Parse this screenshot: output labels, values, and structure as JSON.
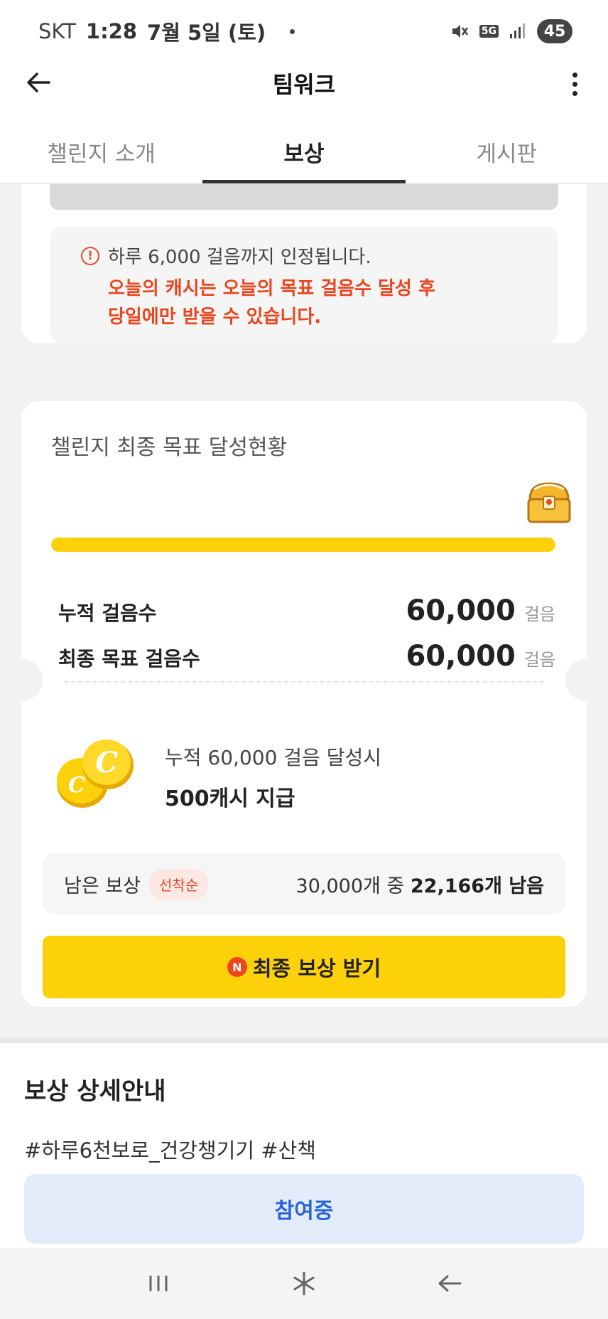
{
  "status_bar": {
    "carrier": "SKT",
    "time": "1:28",
    "date": "7월 5일 (토)",
    "network": "5G",
    "battery": "45"
  },
  "header": {
    "title": "팀워크"
  },
  "tabs": [
    {
      "label": "챌린지 소개",
      "active": false
    },
    {
      "label": "보상",
      "active": true
    },
    {
      "label": "게시판",
      "active": false
    }
  ],
  "notice": {
    "line1": "하루 6,000 걸음까지 인정됩니다.",
    "line2": "오늘의 캐시는 오늘의 목표 걸음수 달성 후",
    "line3": "당일에만 받을 수 있습니다."
  },
  "goal": {
    "title": "챌린지 최종 목표 달성현황",
    "progress": 1.0,
    "accumulated_label": "누적 걸음수",
    "accumulated_value": "60,000",
    "target_label": "최종 목표 걸음수",
    "target_value": "60,000",
    "unit": "걸음",
    "reward_condition": "누적 60,000 걸음 달성시",
    "reward_amount": "500캐시 지급",
    "remain_label": "남은 보상",
    "remain_badge": "선착순",
    "remain_prefix": "30,000개 중",
    "remain_count": "22,166개 남음",
    "claim_button": "최종 보상 받기",
    "claim_icon_letter": "N"
  },
  "detail": {
    "title": "보상 상세안내",
    "hashtags": "#하루6천보로_건강챙기기 #산책",
    "join_button": "참여중"
  },
  "colors": {
    "accent_yellow": "#fdd10a",
    "warning_red": "#e8461e",
    "join_blue": "#2a63d6"
  }
}
